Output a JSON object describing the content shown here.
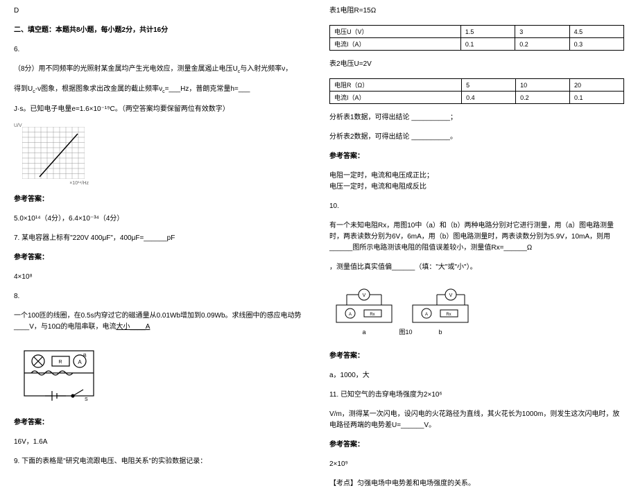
{
  "left": {
    "d_marker": "D",
    "section2": "二、填空题：本题共8小题，每小题2分，共计16分",
    "q6_num": "6.",
    "q6_text1": "（8分）用不同频率的光照射某金属均产生光电效应，测量金属遏止电压",
    "q6_uc1": "U",
    "q6_uc1sub": "c",
    "q6_text1b": "与入射光频率ν，",
    "q6_text2": "得到",
    "q6_uv": "U",
    "q6_uvsub": "c",
    "q6_text2b": "-ν图象，根据图象求出改金属的截止频率ν",
    "q6_cutsub": "c",
    "q6_text2c": "=___Hz，普朗克常量h=___",
    "q6_text3": "J·s。已知电子电量e=1.6×10⁻¹⁹C。（两空答案均要保留两位有效数字）",
    "q6_graph_ylabel": "U/V",
    "q6_graph_xlabel": "×10¹⁴/Hz",
    "ans_label": "参考答案：",
    "q6_ans": "5.0×10¹⁴（4分），6.4×10⁻³⁴（4分）",
    "q7": "7. 某电容器上标有\"220V  400μF\"，400μF=______pF",
    "q7_ans": "4×10⁸",
    "q8_num": "8.",
    "q8_text": "一个100匝的线圈，在0.5s内穿过它的磁通量从0.01Wb增加到0.09Wb。求线圈中的感应电动势____V，与10Ω的电阻串联，电流",
    "q8_under": "大小____A",
    "q8_ans": "16V，1.6A",
    "q9": "9. 下面的表格是\"研究电流跟电压、电阻关系\"的实验数据记录："
  },
  "right": {
    "t1_title": "表1电阻R=15Ω",
    "t1": {
      "r1c1": "电压U（V）",
      "r1c2": "1.5",
      "r1c3": "3",
      "r1c4": "4.5",
      "r2c1": "电流I（A）",
      "r2c2": "0.1",
      "r2c3": "0.2",
      "r2c4": "0.3"
    },
    "t2_title": "表2电压U=2V",
    "t2": {
      "r1c1": "电阻R（Ω）",
      "r1c2": "5",
      "r1c3": "10",
      "r1c4": "20",
      "r2c1": "电流I（A）",
      "r2c2": "0.4",
      "r2c3": "0.2",
      "r2c4": "0.1"
    },
    "q9_blank1": "分析表1数据，可得出结论 __________；",
    "q9_blank2": "分析表2数据，可得出结论 __________。",
    "q9_ans1": "电阻一定时，电流和电压成正比；",
    "q9_ans2": "电压一定时，电流和电阻成反比",
    "q10_num": "10.",
    "q10_text1": "有一个未知电阻Rx，用图10中（a）和（b）两种电路分别对它进行测量，用（a）图电路测量时，两表读数分别为6V，6mA，用（b）图电路测量时，两表读数分别为5.9V，10mA，则用______图所示电路测该电阻的阻值误差较小，测量值Rx=______Ω",
    "q10_text2": "，测量值比真实值偏______（填：\"大\"或\"小\"）。",
    "q10_fig_a": "a",
    "q10_fig_label": "图10",
    "q10_fig_b": "b",
    "q10_ans": "a，1000，大",
    "q11_text1": "11. 已知空气的击穿电场强度为2×10⁶",
    "q11_text2": "V/m，测得某一次闪电，设闪电的火花路径为直线，其火花长为1000m，则发生这次闪电时，放电路径两端的电势差U=______V。",
    "q11_ans": "2×10⁹",
    "q11_kp": "【考点】匀强电场中电势差和电场强度的关系。"
  },
  "chart_data": {
    "type": "line",
    "title": "Uc-ν graph (photoelectric effect)",
    "xlabel": "ν (×10¹⁴ Hz)",
    "ylabel": "Uc (V)",
    "x": [
      5,
      10
    ],
    "y": [
      0,
      2
    ],
    "xlim": [
      0,
      10
    ],
    "ylim": [
      0,
      2
    ],
    "grid": true
  }
}
